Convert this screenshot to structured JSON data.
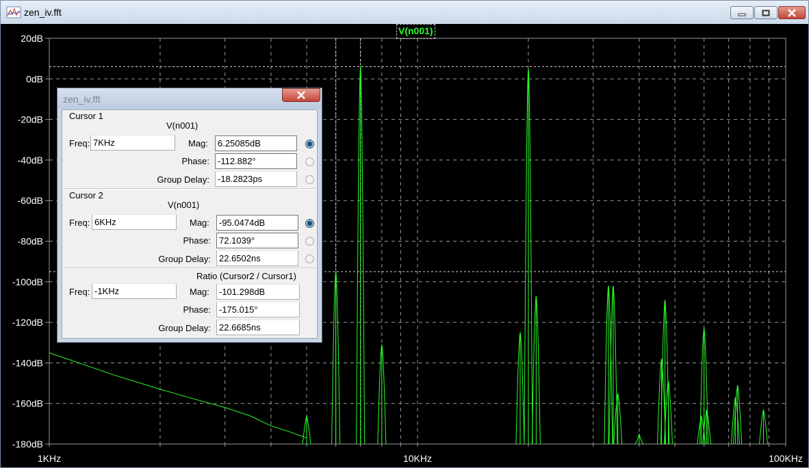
{
  "window": {
    "title": "zen_iv.fft"
  },
  "plot": {
    "trace_label": "V(n001)",
    "trace_color": "#28ff28",
    "background": "#000000"
  },
  "chart_data": {
    "type": "line",
    "xscale": "log",
    "xlim": [
      1000,
      100000
    ],
    "ylim": [
      -180,
      20
    ],
    "x_ticks": [
      "1KHz",
      "10KHz",
      "100KHz"
    ],
    "y_ticks": [
      "20dB",
      "0dB",
      "-20dB",
      "-40dB",
      "-60dB",
      "-80dB",
      "-100dB",
      "-120dB",
      "-140dB",
      "-160dB",
      "-180dB"
    ],
    "grid": true,
    "noise_floor_line": [
      [
        1000,
        -135
      ],
      [
        1500,
        -146
      ],
      [
        2000,
        -153
      ],
      [
        2500,
        -158
      ],
      [
        3000,
        -162
      ],
      [
        3500,
        -166
      ],
      [
        4000,
        -171
      ],
      [
        4500,
        -174
      ],
      [
        5000,
        -177
      ]
    ],
    "peaks": [
      {
        "x": 5000,
        "y": -166
      },
      {
        "x": 6000,
        "y": -95
      },
      {
        "x": 7000,
        "y": 6
      },
      {
        "x": 8000,
        "y": -131
      },
      {
        "x": 19000,
        "y": -125
      },
      {
        "x": 20000,
        "y": 5
      },
      {
        "x": 21000,
        "y": -107
      },
      {
        "x": 33000,
        "y": -102
      },
      {
        "x": 34000,
        "y": -102
      },
      {
        "x": 35000,
        "y": -155
      },
      {
        "x": 40000,
        "y": -175
      },
      {
        "x": 46000,
        "y": -138
      },
      {
        "x": 47000,
        "y": -109
      },
      {
        "x": 48000,
        "y": -149
      },
      {
        "x": 59000,
        "y": -166
      },
      {
        "x": 60000,
        "y": -123
      },
      {
        "x": 61000,
        "y": -163
      },
      {
        "x": 73000,
        "y": -157
      },
      {
        "x": 74000,
        "y": -151
      },
      {
        "x": 87000,
        "y": -163
      }
    ],
    "cursors": [
      {
        "x": 6000,
        "y": -95
      },
      {
        "x": 7000,
        "y": 6
      }
    ]
  },
  "dialog": {
    "title": "zen_iv.fft",
    "cursor1": {
      "heading": "Cursor 1",
      "trace": "V(n001)",
      "freq_label": "Freq:",
      "freq": "7KHz",
      "mag_label": "Mag:",
      "mag": "6.25085dB",
      "phase_label": "Phase:",
      "phase": "-112.882°",
      "group_delay_label": "Group Delay:",
      "group_delay": "-18.2823ps"
    },
    "cursor2": {
      "heading": "Cursor 2",
      "trace": "V(n001)",
      "freq_label": "Freq:",
      "freq": "6KHz",
      "mag_label": "Mag:",
      "mag": "-95.0474dB",
      "phase_label": "Phase:",
      "phase": "72.1039°",
      "group_delay_label": "Group Delay:",
      "group_delay": "22.6502ns"
    },
    "ratio": {
      "heading": "Ratio (Cursor2 / Cursor1)",
      "freq_label": "Freq:",
      "freq": "-1KHz",
      "mag_label": "Mag:",
      "mag": "-101.298dB",
      "phase_label": "Phase:",
      "phase": "-175.015°",
      "group_delay_label": "Group Delay:",
      "group_delay": "22.6685ns"
    }
  }
}
